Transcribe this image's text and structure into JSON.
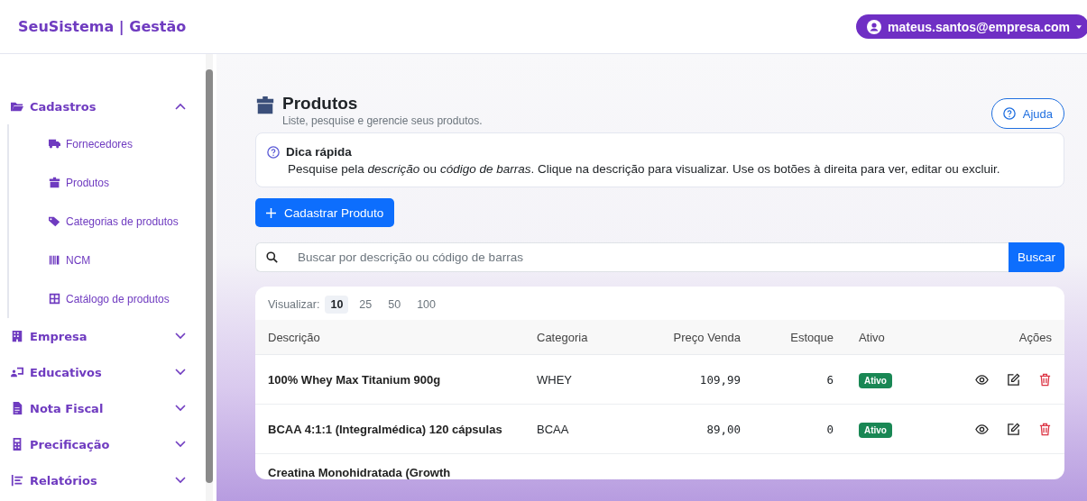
{
  "header": {
    "brand": "SeuSistema | Gestão",
    "user": "mateus.santos@empresa.com"
  },
  "sidebar": {
    "groups": [
      {
        "label": "Cadastros",
        "expanded": true,
        "children": [
          {
            "label": "Fornecedores"
          },
          {
            "label": "Produtos"
          },
          {
            "label": "Categorias de produtos"
          },
          {
            "label": "NCM"
          },
          {
            "label": "Catálogo de produtos"
          }
        ]
      },
      {
        "label": "Empresa",
        "expanded": false
      },
      {
        "label": "Educativos",
        "expanded": false
      },
      {
        "label": "Nota Fiscal",
        "expanded": false
      },
      {
        "label": "Precificação",
        "expanded": false
      },
      {
        "label": "Relatórios",
        "expanded": false
      }
    ]
  },
  "page": {
    "title": "Produtos",
    "subtitle": "Liste, pesquise e gerencie seus produtos.",
    "help_button": "Ajuda"
  },
  "tip": {
    "title": "Dica rápida",
    "text": "Pesquise pela *descrição* ou *código de barras*. Clique na descrição para visualizar. Use os botões à direita para ver, editar ou excluir."
  },
  "new_button": "Cadastrar Produto",
  "search": {
    "placeholder": "Buscar por descrição ou código de barras",
    "button": "Buscar"
  },
  "page_size": {
    "label": "Visualizar:",
    "options": [
      {
        "label": "10",
        "selected": true
      },
      {
        "label": "25",
        "selected": false
      },
      {
        "label": "50",
        "selected": false
      },
      {
        "label": "100",
        "selected": false
      }
    ]
  },
  "table": {
    "columns": [
      "Descrição",
      "Categoria",
      "Preço Venda",
      "Estoque",
      "Ativo",
      "Ações"
    ],
    "rows": [
      {
        "description": "100% Whey Max Titanium 900g",
        "category": "WHEY",
        "price": "109,99",
        "stock": "6",
        "status": "Ativo",
        "active": true
      },
      {
        "description": "BCAA 4:1:1 (Integralmédica) 120 cápsulas",
        "category": "BCAA",
        "price": "89,00",
        "stock": "0",
        "status": "Ativo",
        "active": true
      },
      {
        "description": "Creatina Monohidratada (Growth"
      }
    ]
  }
}
